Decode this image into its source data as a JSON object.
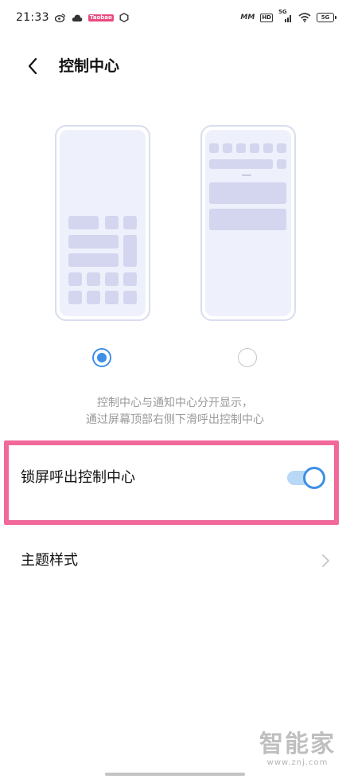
{
  "status_bar": {
    "time": "21:33",
    "left_icons": [
      "weibo-icon",
      "cloud-icon",
      "app-badge-icon",
      "hexagon-icon"
    ],
    "badge_text": "Taobao",
    "network_speed": "MM",
    "hd_label": "HD",
    "network_type": "5G",
    "battery_label": "5G"
  },
  "header": {
    "back_icon": "chevron-left-icon",
    "title": "控制中心"
  },
  "style_options": [
    {
      "name": "combined-layout",
      "selected": true
    },
    {
      "name": "separate-layout",
      "selected": false
    }
  ],
  "description": {
    "line1": "控制中心与通知中心分开显示，",
    "line2": "通过屏幕顶部右侧下滑呼出控制中心"
  },
  "settings": {
    "lock_screen": {
      "label": "锁屏呼出控制中心",
      "enabled": true
    },
    "theme": {
      "label": "主题样式",
      "icon": "chevron-right-icon"
    }
  },
  "watermark": {
    "logo": "智能家",
    "url": "www.znj.com"
  },
  "colors": {
    "accent": "#3e8fe6",
    "highlight": "#f0699a",
    "tile": "#d3d6ee"
  }
}
